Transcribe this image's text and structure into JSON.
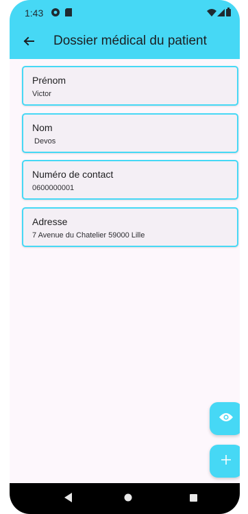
{
  "status_bar": {
    "time": "1:43",
    "icons": [
      "circle-notification-icon",
      "sim-card-icon",
      "wifi-icon",
      "signal-icon",
      "battery-icon"
    ]
  },
  "app_bar": {
    "title": "Dossier médical du patient",
    "back_icon": "arrow-left-icon"
  },
  "fields": [
    {
      "label": "Prénom",
      "value": "Victor"
    },
    {
      "label": "Nom",
      "value": " Devos"
    },
    {
      "label": "Numéro de contact",
      "value": "0600000001"
    },
    {
      "label": "Adresse",
      "value": "7 Avenue du Chatelier 59000 Lille"
    }
  ],
  "fabs": {
    "view_icon": "eye-icon",
    "add_icon": "plus-icon"
  },
  "nav": {
    "icons": [
      "back-triangle-icon",
      "home-circle-icon",
      "recents-square-icon"
    ]
  },
  "colors": {
    "accent": "#46d8f5",
    "background": "#fdf7fc",
    "card_background": "#f4eff5",
    "nav_bar": "#000000"
  }
}
